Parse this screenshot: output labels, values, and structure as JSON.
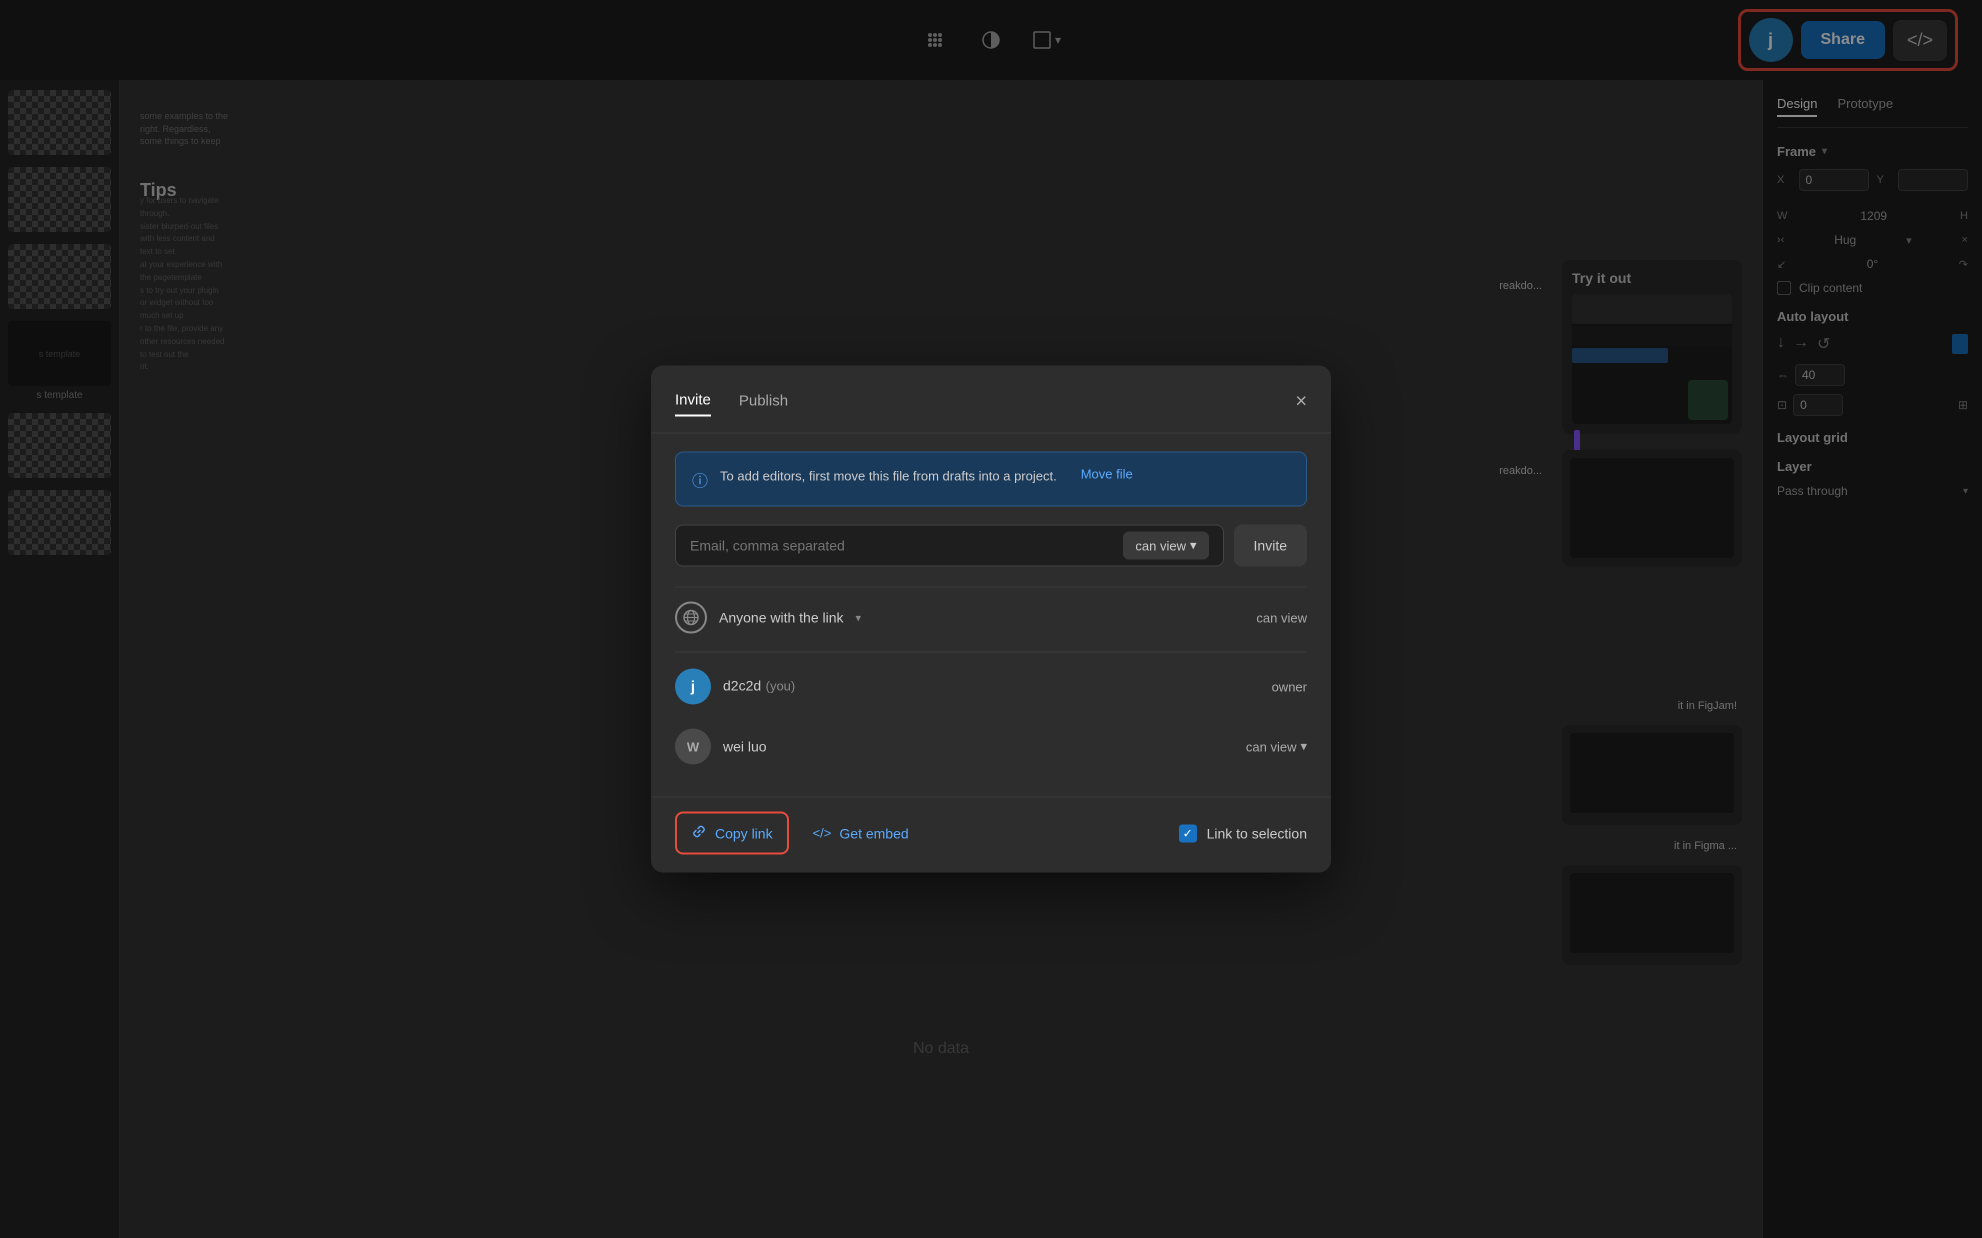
{
  "toolbar": {
    "center_icons": [
      "grid-icon",
      "contrast-icon",
      "shape-icon"
    ],
    "share_label": "Share",
    "embed_icon": "</>",
    "avatar_letter": "j"
  },
  "right_panel": {
    "tabs": [
      "Design",
      "Prototype"
    ],
    "active_tab": "Design",
    "frame_label": "Frame",
    "x_label": "X",
    "x_value": "0",
    "y_label": "Y",
    "w_label": "W",
    "w_value": "1209",
    "h_label": "H",
    "hug_label": "Hug",
    "rotation_label": "0°",
    "clip_content_label": "Clip content",
    "auto_layout_label": "Auto layout",
    "spacing_value": "40",
    "padding_value": "0",
    "layout_grid_label": "Layout grid",
    "layer_label": "Layer",
    "pass_through_label": "Pass through"
  },
  "modal": {
    "tabs": [
      "Invite",
      "Publish"
    ],
    "active_tab": "Invite",
    "close_aria": "Close dialog",
    "info_banner_text": "To add editors, first move this file from drafts into a project.",
    "move_file_label": "Move file",
    "email_placeholder": "Email, comma separated",
    "can_view_label": "can view",
    "invite_button_label": "Invite",
    "anyone_link_label": "Anyone with the link",
    "anyone_can_view": "can view",
    "user1_name": "d2c2d",
    "user1_you": "(you)",
    "user1_role": "owner",
    "user2_name": "wei luo",
    "user2_role": "can view",
    "copy_link_label": "Copy link",
    "get_embed_label": "Get embed",
    "link_to_selection_label": "Link to selection"
  },
  "canvas": {
    "tips_label": "Tips",
    "try_it_out_label": "Try it out",
    "breakdown_label1": "reakdo...",
    "breakdown_label2": "reakdo...",
    "figjam_label": "it in FigJam!",
    "figma_label": "it in Figma ...",
    "no_data_label": "No data",
    "template_label": "s template"
  },
  "icons": {
    "globe": "🌐",
    "link": "🔗",
    "code": "</>",
    "check": "✓",
    "info": "ℹ",
    "chevron_down": "∨",
    "arrow_down": "↓",
    "arrow_right": "→",
    "arrow_loop": "↺",
    "grid": "⊞",
    "contrast": "◑",
    "close": "×"
  }
}
